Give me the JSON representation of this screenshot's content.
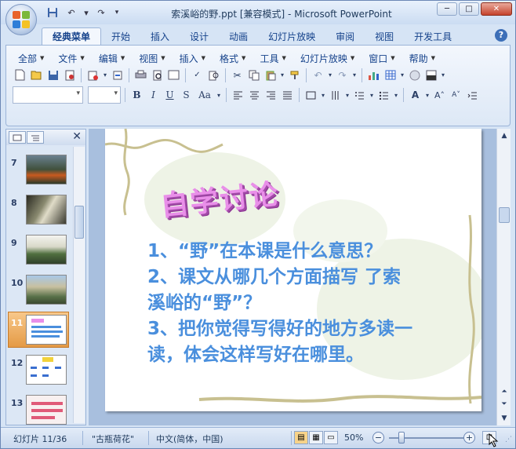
{
  "window": {
    "title": "索溪峪的野.ppt [兼容模式] - Microsoft PowerPoint",
    "controls": {
      "minimize": "─",
      "maximize": "□",
      "close": "✕"
    }
  },
  "qat": [
    "save-icon",
    "undo-icon",
    "redo-icon",
    "dropdown-icon"
  ],
  "tabs": [
    "经典菜单",
    "开始",
    "插入",
    "设计",
    "动画",
    "幻灯片放映",
    "审阅",
    "视图",
    "开发工具"
  ],
  "active_tab": "经典菜单",
  "help": "?",
  "menus": [
    "全部",
    "文件",
    "编辑",
    "视图",
    "插入",
    "格式",
    "工具",
    "幻灯片放映",
    "窗口",
    "帮助"
  ],
  "format_buttons": {
    "bold": "B",
    "italic": "I",
    "underline": "U",
    "strike": "S",
    "case": "Aa"
  },
  "thumbnails": {
    "numbers": [
      "7",
      "8",
      "9",
      "10",
      "11",
      "12",
      "13"
    ],
    "active": "11"
  },
  "slide": {
    "title": "自学讨论",
    "lines": [
      "1、“野”在本课是什么意思？",
      "2、课文从哪几个方面描写 了索",
      "溪峪的“野”？",
      "3、把你觉得写得好的地方多读一",
      "读，体会这样写好在哪里。"
    ]
  },
  "status": {
    "slide_info": "幻灯片 11/36",
    "theme": "\"古瓶荷花\"",
    "language": "中文(简体，中国)",
    "zoom": "50%"
  },
  "colors": {
    "accent": "#15428b",
    "slide_text": "#4a8fdd",
    "title_pink": "#e98fe9"
  }
}
